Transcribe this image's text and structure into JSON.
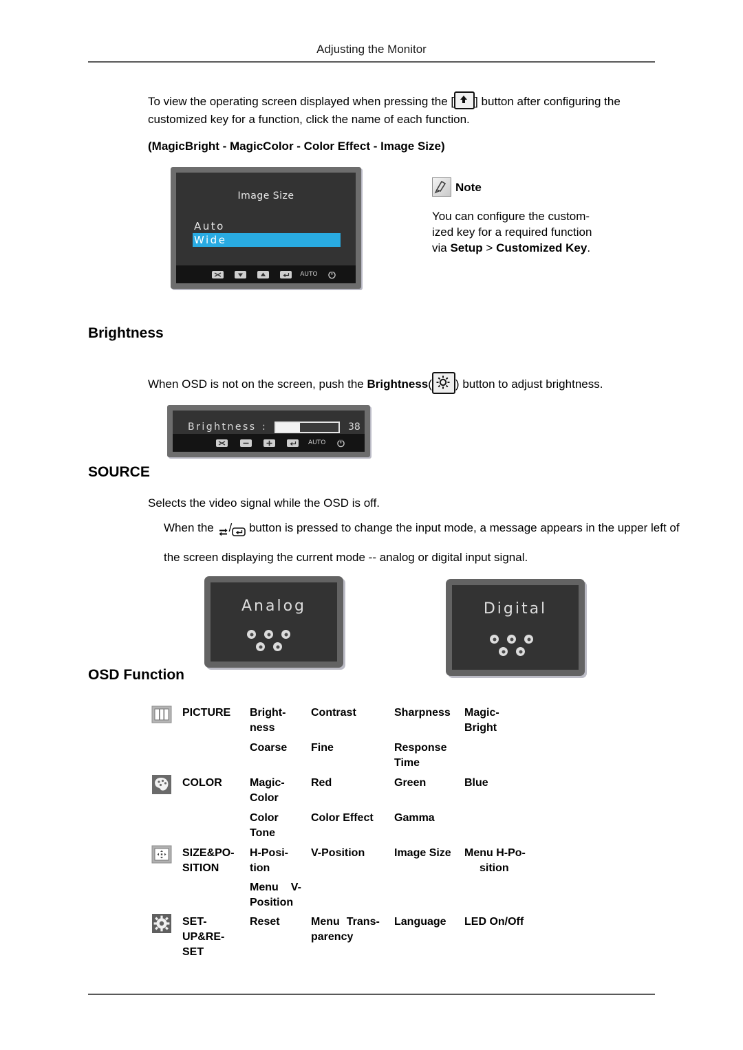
{
  "document": {
    "header_title": "Adjusting the Monitor",
    "intro_paragraph_line1_pre": "To view the operating screen displayed when pressing the [",
    "intro_paragraph_line1_post": "] button after configuring the",
    "intro_paragraph_line2": "customized key for a function, click the name of each function.",
    "function_list": "(MagicBright - MagicColor - Color Effect - Image Size)"
  },
  "image_size_osd": {
    "title": "Image Size",
    "option_auto": "Auto",
    "option_wide": "Wide",
    "selected_option": "Wide",
    "highlight_color": "#29ABE2",
    "buttons": [
      "close-icon",
      "down-icon",
      "up-icon",
      "enter-icon",
      "AUTO",
      "power-icon"
    ],
    "auto_label": "AUTO"
  },
  "note": {
    "label": "Note",
    "line1": "You can configure the custom-",
    "line2": "ized key for a required function",
    "line3_pre": "via ",
    "line3_bold1": "Setup",
    "line3_mid": " > ",
    "line3_bold2": "Customized Key",
    "line3_post": "."
  },
  "brightness": {
    "heading": "Brightness",
    "desc_pre": "When OSD is not on the screen, push the ",
    "desc_bold": "Brightness",
    "desc_paren_open": "(",
    "desc_paren_close": ")",
    "desc_post": " button to adjust brightness.",
    "osd_label": "Brightness",
    "osd_colon": ":",
    "osd_value": "38",
    "osd_percent": 38,
    "buttons": [
      "close-icon",
      "minus-icon",
      "plus-icon",
      "enter-icon",
      "AUTO",
      "power-icon"
    ],
    "auto_label": "AUTO"
  },
  "source": {
    "heading": "SOURCE",
    "line1": "Selects the video signal while the OSD is off.",
    "line2_pre": "When the ",
    "line2_sep": "/",
    "line2_post": " button is pressed to change the input mode, a message appears in the upper left of",
    "line3": "the screen displaying the current mode -- analog or digital input signal.",
    "analog_panel_text": "Analog",
    "digital_panel_text": "Digital"
  },
  "osd_function": {
    "heading": "OSD Function",
    "rows": [
      {
        "icon": "picture-icon",
        "label": "PICTURE",
        "lines": [
          [
            "Bright-­ness",
            "Contrast",
            "Sharpness",
            "Magic-­Bright"
          ],
          [
            "Coarse",
            "Fine",
            "Response Time",
            ""
          ]
        ]
      },
      {
        "icon": "color-icon",
        "label": "COLOR",
        "lines": [
          [
            "Magic-­Color",
            "Red",
            "Green",
            "Blue"
          ],
          [
            "Color Tone",
            "Color Effect",
            "Gamma",
            ""
          ]
        ]
      },
      {
        "icon": "size-position-icon",
        "label": "SIZE&PO-­SITION",
        "lines": [
          [
            "H-Posi-­tion",
            "V-Position",
            "Image Size",
            "Menu H-Po-­sition"
          ],
          [
            "Menu   V-­Position",
            "",
            "",
            ""
          ]
        ]
      },
      {
        "icon": "setup-reset-icon",
        "label": "SET-­UP&RE-­SET",
        "lines": [
          [
            "Reset",
            "Menu   Trans-­parency",
            "Language",
            "LED On/Off"
          ]
        ]
      }
    ],
    "cells": {
      "picture_label": "PICTURE",
      "picture_r1c1": "Bright-",
      "picture_r1c1b": "ness",
      "picture_r1c2": "Contrast",
      "picture_r1c3": "Sharpness",
      "picture_r1c4": "Magic-",
      "picture_r1c4b": "Bright",
      "picture_r2c1": "Coarse",
      "picture_r2c2": "Fine",
      "picture_r2c3": "Response",
      "picture_r2c3b": "Time",
      "color_label": "COLOR",
      "color_r1c1": "Magic-",
      "color_r1c1b": "Color",
      "color_r1c2": "Red",
      "color_r1c3": "Green",
      "color_r1c4": "Blue",
      "color_r2c1": "Color",
      "color_r2c1b": "Tone",
      "color_r2c2": "Color Effect",
      "color_r2c3": "Gamma",
      "size_label": "SIZE&PO-",
      "size_labelb": "SITION",
      "size_r1c1": "H-Posi-",
      "size_r1c1b": "tion",
      "size_r1c2": "V-Position",
      "size_r1c3": "Image Size",
      "size_r1c4": "Menu H-Po-",
      "size_r1c4b": "sition",
      "size_r2c1": "Menu",
      "size_r2c1v": "V-",
      "size_r2c1b": "Position",
      "setup_label": "SET-",
      "setup_labelb": "UP&RE-",
      "setup_labelc": "SET",
      "setup_r1c1": "Reset",
      "setup_r1c2": "Menu",
      "setup_r1c2t": "Trans-",
      "setup_r1c2b": "parency",
      "setup_r1c3": "Language",
      "setup_r1c4": "LED On/Off"
    }
  }
}
